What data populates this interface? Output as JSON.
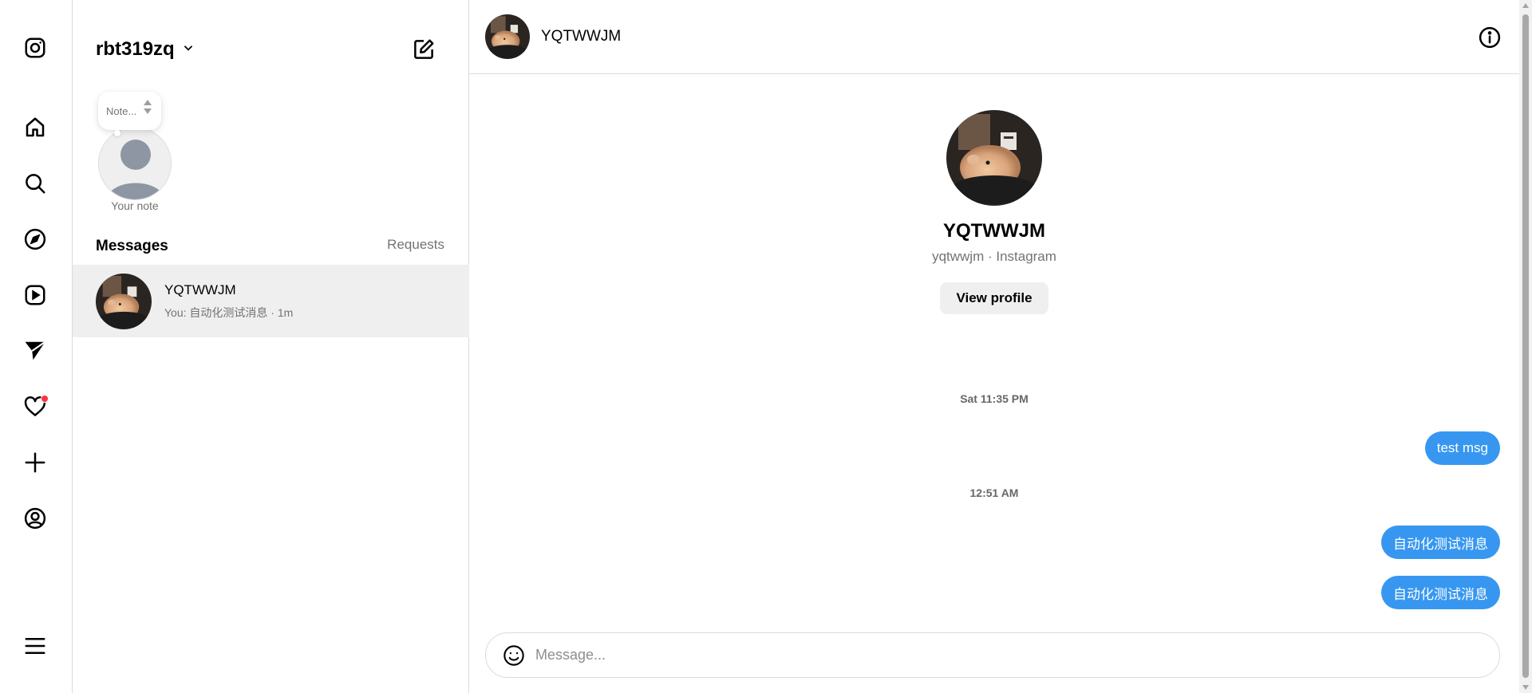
{
  "account": {
    "username": "rbt319zq"
  },
  "note": {
    "placeholder": "Note...",
    "label": "Your note"
  },
  "inbox": {
    "messages_title": "Messages",
    "requests_label": "Requests",
    "threads": [
      {
        "name": "YQTWWJM",
        "preview": "You: 自动化测试消息 · 1m"
      }
    ]
  },
  "conversation": {
    "header_name": "YQTWWJM",
    "profile": {
      "name": "YQTWWJM",
      "subtitle": "yqtwwjm · Instagram",
      "view_profile_label": "View profile"
    },
    "timestamps": [
      "Sat 11:35 PM",
      "12:51 AM"
    ],
    "messages": [
      "test msg",
      "自动化测试消息",
      "自动化测试消息"
    ],
    "composer_placeholder": "Message..."
  },
  "nav_icons": [
    "instagram-icon",
    "home-icon",
    "search-icon",
    "explore-icon",
    "reels-icon",
    "messages-icon",
    "notifications-icon",
    "create-icon",
    "profile-icon",
    "menu-icon"
  ],
  "colors": {
    "accent": "#3797f0",
    "notification": "#ff3040",
    "selected_row": "#efefef"
  }
}
